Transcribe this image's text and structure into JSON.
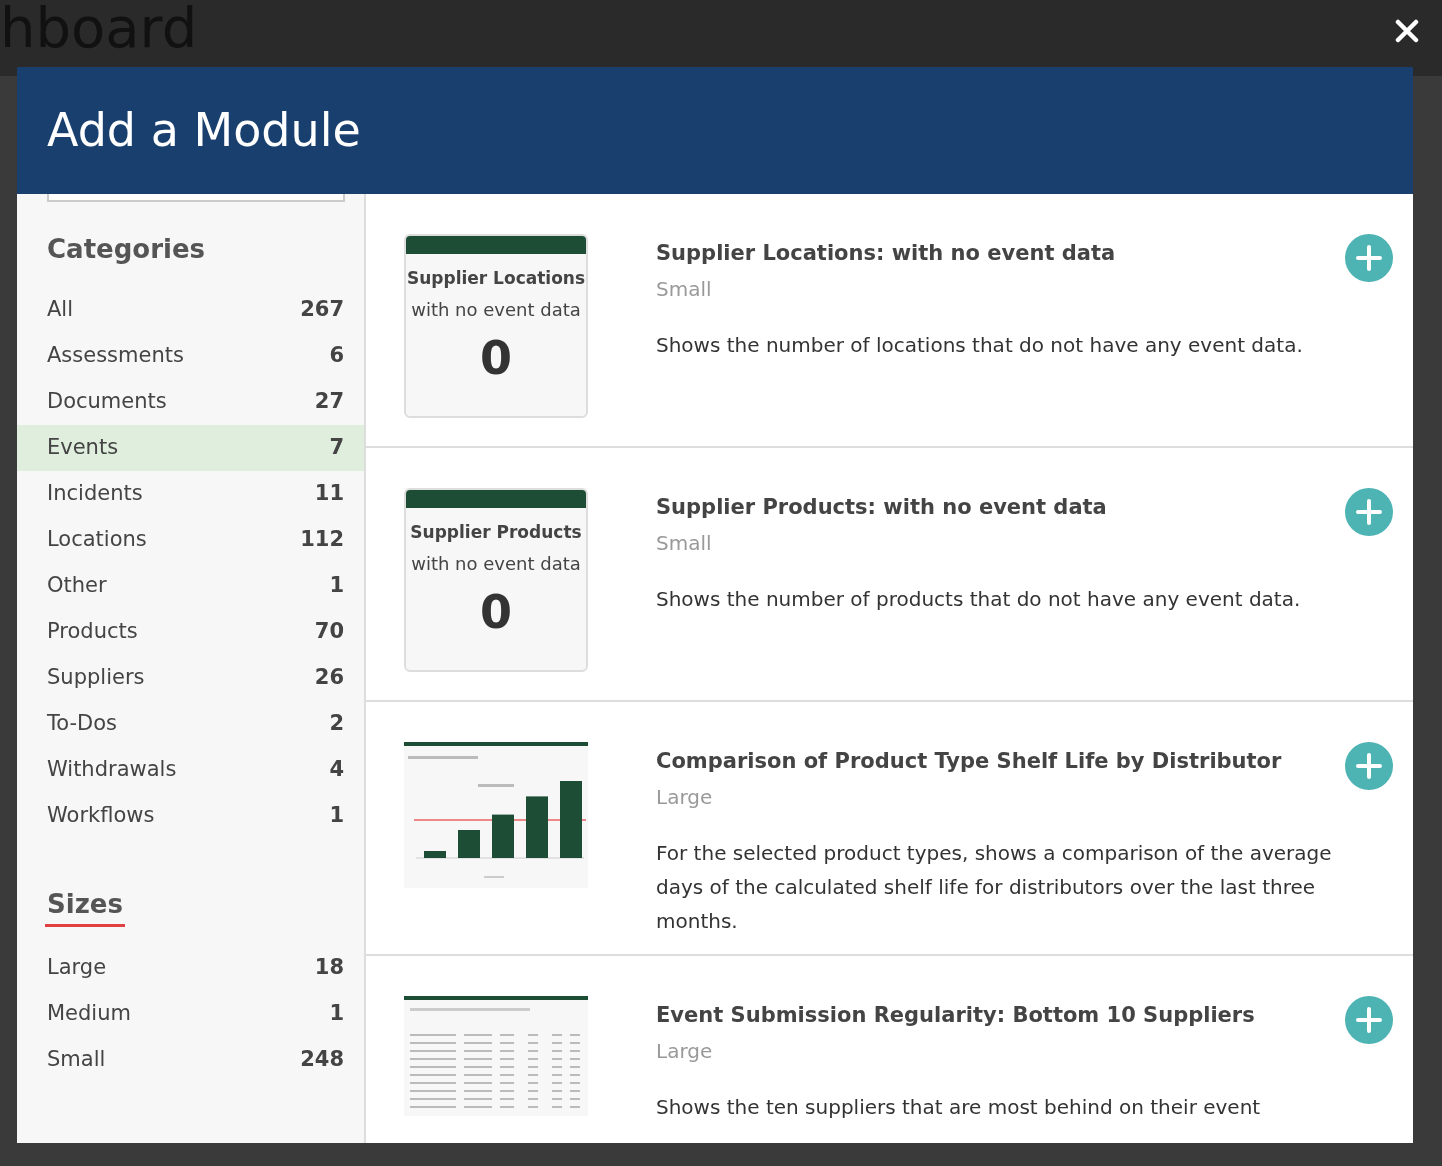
{
  "backdrop": {
    "title": "hboard"
  },
  "modal": {
    "title": "Add a Module"
  },
  "sidebar": {
    "categories_heading": "Categories",
    "categories": [
      {
        "label": "All",
        "count": "267",
        "selected": false
      },
      {
        "label": "Assessments",
        "count": "6",
        "selected": false
      },
      {
        "label": "Documents",
        "count": "27",
        "selected": false
      },
      {
        "label": "Events",
        "count": "7",
        "selected": true
      },
      {
        "label": "Incidents",
        "count": "11",
        "selected": false
      },
      {
        "label": "Locations",
        "count": "112",
        "selected": false
      },
      {
        "label": "Other",
        "count": "1",
        "selected": false
      },
      {
        "label": "Products",
        "count": "70",
        "selected": false
      },
      {
        "label": "Suppliers",
        "count": "26",
        "selected": false
      },
      {
        "label": "To-Dos",
        "count": "2",
        "selected": false
      },
      {
        "label": "Withdrawals",
        "count": "4",
        "selected": false
      },
      {
        "label": "Workflows",
        "count": "1",
        "selected": false
      }
    ],
    "sizes_heading": "Sizes",
    "sizes": [
      {
        "label": "Large",
        "count": "18",
        "selected": false
      },
      {
        "label": "Medium",
        "count": "1",
        "selected": false
      },
      {
        "label": "Small",
        "count": "248",
        "selected": false
      }
    ]
  },
  "modules": [
    {
      "title": "Supplier Locations: with no event data",
      "size": "Small",
      "description": "Shows the number of locations that do not have any event data.",
      "preview": {
        "kind": "card",
        "title": "Supplier Locations",
        "subtitle": "with no event data",
        "value": "0"
      }
    },
    {
      "title": "Supplier Products: with no event data",
      "size": "Small",
      "description": "Shows the number of products that do not have any event data.",
      "preview": {
        "kind": "card",
        "title": "Supplier Products",
        "subtitle": "with no event data",
        "value": "0"
      }
    },
    {
      "title": "Comparison of Product Type Shelf Life by Distributor",
      "size": "Large",
      "description": "For the selected product types, shows a comparison of the average days of the calculated shelf life for distributors over the last three months.",
      "preview": {
        "kind": "chart"
      }
    },
    {
      "title": "Event Submission Regularity: Bottom 10 Suppliers",
      "size": "Large",
      "description": "Shows the ten suppliers that are most behind on their event",
      "preview": {
        "kind": "table"
      }
    }
  ]
}
